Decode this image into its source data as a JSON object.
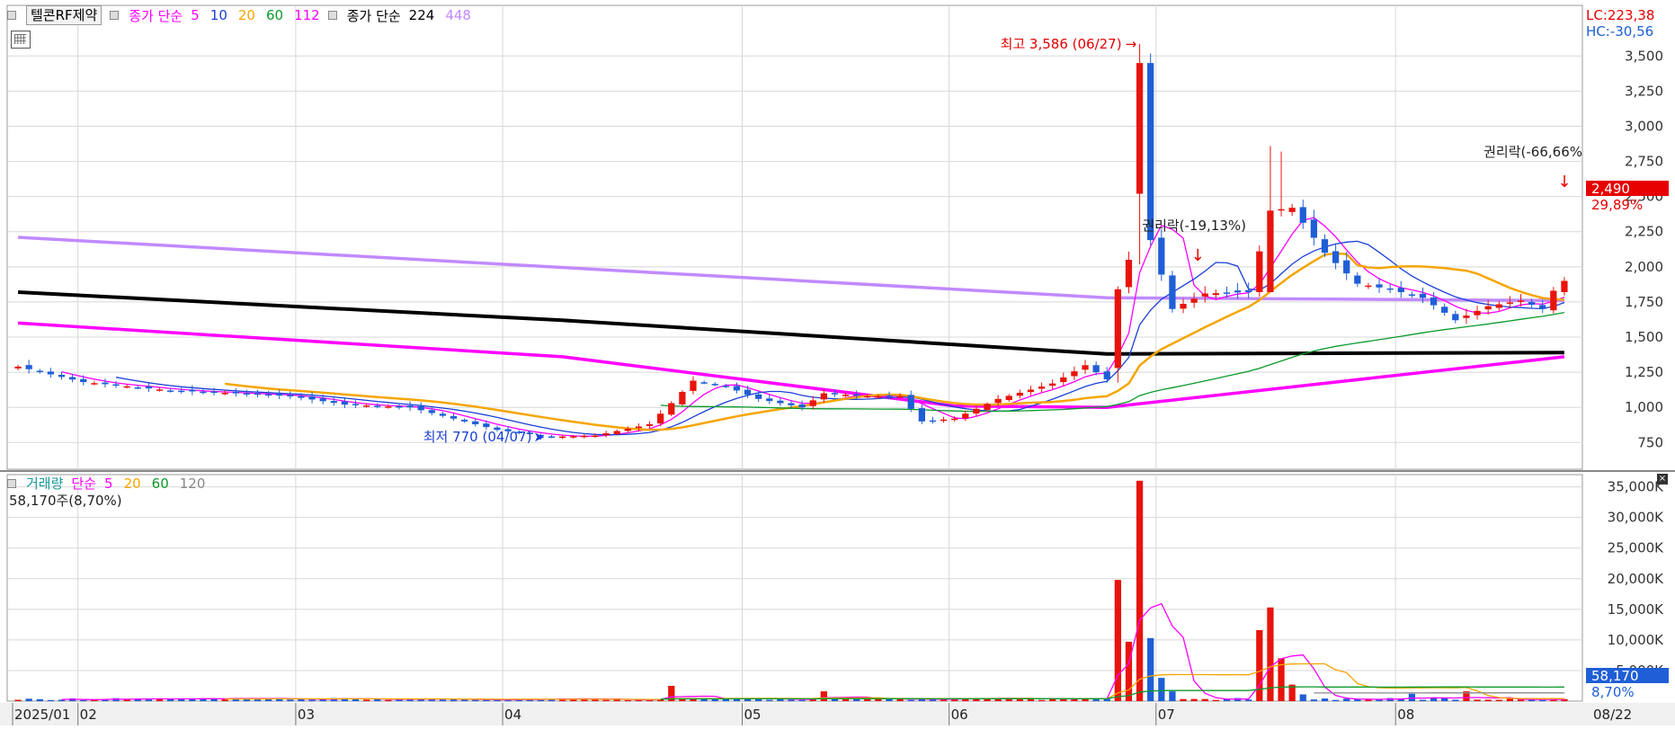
{
  "stock_name": "텔콘RF제약",
  "price_legend": {
    "ma_prefix": "종가 단순",
    "ma_items": [
      {
        "label": "5",
        "color": "#ff00ff"
      },
      {
        "label": "10",
        "color": "#1a3fd6"
      },
      {
        "label": "20",
        "color": "#f5a500"
      },
      {
        "label": "60",
        "color": "#0a9a2a"
      },
      {
        "label": "112",
        "color": "#ff00ff"
      }
    ],
    "ma2_prefix": "종가 단순",
    "ma2_items": [
      {
        "label": "224",
        "color": "#000000"
      },
      {
        "label": "448",
        "color": "#c08aff"
      }
    ]
  },
  "volume_legend": {
    "title": "거래량",
    "title_color": "#1a9a9a",
    "ma_prefix": "단순",
    "items": [
      {
        "label": "5",
        "color": "#ff00ff"
      },
      {
        "label": "20",
        "color": "#f5a500"
      },
      {
        "label": "60",
        "color": "#0a9a2a"
      },
      {
        "label": "120",
        "color": "#888888"
      }
    ],
    "readout": "58,170주(8,70%)"
  },
  "status": {
    "lc": "LC:223,38",
    "hc": "HC:-30,56",
    "lc_color": "#e60000",
    "hc_color": "#1a5fd6"
  },
  "price_tag": {
    "value": "2,490",
    "change": "29,89%"
  },
  "volume_tag": {
    "value": "58,170",
    "change": "8,70%"
  },
  "annotations": {
    "high": "최고 3,586 (06/27)",
    "low": "최저 770 (04/07)",
    "rights1": "권리락(-19,13%)",
    "rights2": "권리락(-66,66%"
  },
  "x_axis": {
    "labels": [
      "2025/01",
      "02",
      "03",
      "04",
      "05",
      "06",
      "07",
      "08"
    ],
    "end_label": "08/22"
  },
  "colors": {
    "up": "#e8140c",
    "down": "#1f5ed6",
    "grid": "#d8d8d8"
  },
  "chart_data": [
    {
      "type": "candlestick",
      "series_name": "텔콘RF제약",
      "y_ticks": [
        750,
        1000,
        1250,
        1500,
        1750,
        2000,
        2250,
        2500,
        2750,
        3000,
        3250,
        3500
      ],
      "y_tick_labels": [
        "750",
        "1,000",
        "1,250",
        "1,500",
        "1,750",
        "2,000",
        "2,250",
        "2,500",
        "2,750",
        "3,000",
        "3,250",
        "3,500"
      ],
      "ylim": [
        560,
        3860
      ],
      "months": [
        {
          "label": "2025/01",
          "start": 0
        },
        {
          "label": "02",
          "start": 6
        },
        {
          "label": "03",
          "start": 26
        },
        {
          "label": "04",
          "start": 45
        },
        {
          "label": "05",
          "start": 67
        },
        {
          "label": "06",
          "start": 86
        },
        {
          "label": "07",
          "start": 105
        },
        {
          "label": "08",
          "start": 127
        }
      ],
      "n_points": 143,
      "anchors": [
        {
          "i": 0,
          "c": 1290
        },
        {
          "i": 6,
          "c": 1180
        },
        {
          "i": 10,
          "c": 1150
        },
        {
          "i": 14,
          "c": 1120
        },
        {
          "i": 20,
          "c": 1100
        },
        {
          "i": 25,
          "c": 1080
        },
        {
          "i": 30,
          "c": 1020
        },
        {
          "i": 36,
          "c": 1000
        },
        {
          "i": 40,
          "c": 920
        },
        {
          "i": 44,
          "c": 840
        },
        {
          "i": 49,
          "c": 790
        },
        {
          "i": 53,
          "c": 800
        },
        {
          "i": 58,
          "c": 880
        },
        {
          "i": 60,
          "c": 1030
        },
        {
          "i": 62,
          "c": 1190
        },
        {
          "i": 65,
          "c": 1150
        },
        {
          "i": 68,
          "c": 1060
        },
        {
          "i": 72,
          "c": 1000
        },
        {
          "i": 74,
          "c": 1100
        },
        {
          "i": 78,
          "c": 1080
        },
        {
          "i": 81,
          "c": 1080
        },
        {
          "i": 83,
          "c": 900
        },
        {
          "i": 86,
          "c": 920
        },
        {
          "i": 90,
          "c": 1060
        },
        {
          "i": 95,
          "c": 1170
        },
        {
          "i": 98,
          "c": 1300
        },
        {
          "i": 100,
          "c": 1200
        },
        {
          "i": 101,
          "c": 1840
        },
        {
          "i": 102,
          "c": 2050
        },
        {
          "i": 103,
          "c": 3450
        },
        {
          "i": 104,
          "c": 2190
        },
        {
          "i": 106,
          "c": 1700
        },
        {
          "i": 109,
          "c": 1810
        },
        {
          "i": 113,
          "c": 1820
        },
        {
          "i": 115,
          "c": 2400
        },
        {
          "i": 117,
          "c": 2420
        },
        {
          "i": 120,
          "c": 2100
        },
        {
          "i": 123,
          "c": 1880
        },
        {
          "i": 126,
          "c": 1840
        },
        {
          "i": 129,
          "c": 1780
        },
        {
          "i": 132,
          "c": 1620
        },
        {
          "i": 135,
          "c": 1720
        },
        {
          "i": 138,
          "c": 1760
        },
        {
          "i": 140,
          "c": 1700
        },
        {
          "i": 141,
          "c": 1830
        },
        {
          "i": 142,
          "c": 1900
        }
      ],
      "high": {
        "value": 3586,
        "date": "06/27"
      },
      "low": {
        "value": 770,
        "date": "04/07"
      },
      "ma_lines": [
        {
          "period": 5,
          "color": "#ff00ff"
        },
        {
          "period": 10,
          "color": "#1a3fd6"
        },
        {
          "period": 20,
          "color": "#f5a500"
        },
        {
          "period": 60,
          "color": "#0a9a2a"
        }
      ],
      "long_ma_lines": [
        {
          "period": 112,
          "color": "#ff00ff",
          "points": [
            [
              0,
              1600
            ],
            [
              50,
              1360
            ],
            [
              86,
              1010
            ],
            [
              100,
              1000
            ],
            [
              142,
              1360
            ]
          ]
        },
        {
          "period": 224,
          "color": "#000000",
          "points": [
            [
              0,
              1820
            ],
            [
              50,
              1620
            ],
            [
              100,
              1380
            ],
            [
              142,
              1390
            ]
          ]
        },
        {
          "period": 448,
          "color": "#c08aff",
          "points": [
            [
              0,
              2210
            ],
            [
              100,
              1780
            ],
            [
              142,
              1760
            ]
          ]
        }
      ]
    },
    {
      "type": "bar",
      "series_name": "거래량",
      "y_ticks": [
        5000,
        10000,
        15000,
        20000,
        25000,
        30000,
        35000
      ],
      "y_tick_labels": [
        "5,000K",
        "10,000K",
        "15,000K",
        "20,000K",
        "25,000K",
        "30,000K",
        "35,000K"
      ],
      "ylim": [
        0,
        37000
      ],
      "spikes": [
        {
          "i": 60,
          "v": 2500
        },
        {
          "i": 74,
          "v": 1600
        },
        {
          "i": 101,
          "v": 19800
        },
        {
          "i": 102,
          "v": 9700
        },
        {
          "i": 103,
          "v": 36000
        },
        {
          "i": 104,
          "v": 10300
        },
        {
          "i": 105,
          "v": 3800
        },
        {
          "i": 106,
          "v": 1600
        },
        {
          "i": 114,
          "v": 11600
        },
        {
          "i": 115,
          "v": 15300
        },
        {
          "i": 116,
          "v": 7000
        },
        {
          "i": 117,
          "v": 2700
        },
        {
          "i": 118,
          "v": 1100
        },
        {
          "i": 128,
          "v": 1200
        },
        {
          "i": 133,
          "v": 1600
        }
      ],
      "base_volume": 280,
      "ma_lines": [
        {
          "period": 5,
          "color": "#ff00ff"
        },
        {
          "period": 20,
          "color": "#f5a500"
        },
        {
          "period": 60,
          "color": "#0a9a2a"
        },
        {
          "period": 120,
          "color": "#888888"
        }
      ]
    }
  ]
}
